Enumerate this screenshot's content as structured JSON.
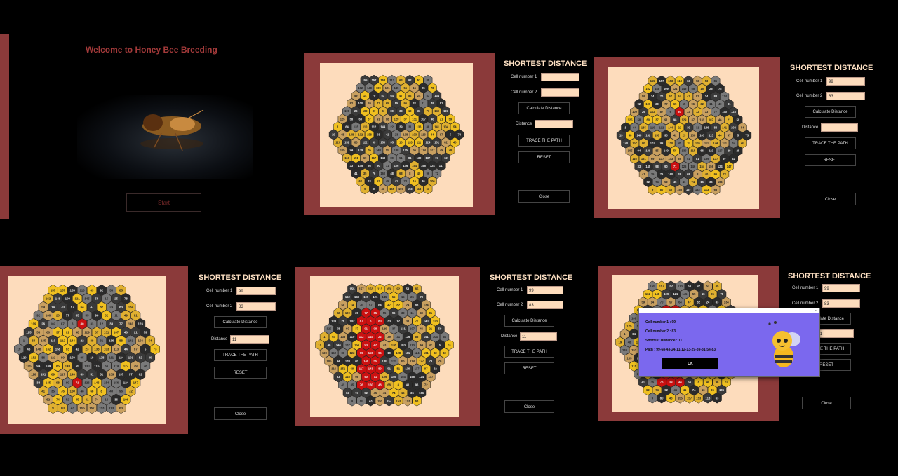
{
  "welcome": {
    "title": "Welcome to Honey Bee Breeding",
    "start_label": "Start"
  },
  "panels": [
    {
      "title": "SHORTEST DISTANCE",
      "cell1_label": "Cell number 1",
      "cell2_label": "Cell number 2",
      "cell1": "",
      "cell2": "",
      "calc_label": "Calculate Distance",
      "distance_label": "Distance",
      "distance": "",
      "trace_label": "TRACE THE PATH",
      "reset_label": "RESET",
      "close_label": "Close"
    },
    {
      "title": "SHORTEST DISTANCE",
      "cell1_label": "Cell number 1",
      "cell2_label": "Cell number 2",
      "cell1": "99",
      "cell2": "83",
      "calc_label": "Calculate Distance",
      "distance_label": "Distance",
      "distance": "",
      "trace_label": "TRACE THE PATH",
      "reset_label": "RESET",
      "close_label": "Close"
    },
    {
      "title": "SHORTEST DISTANCE",
      "cell1_label": "Cell number 1",
      "cell2_label": "Cell number 2",
      "cell1": "99",
      "cell2": "83",
      "calc_label": "Calculate Distance",
      "distance_label": "Distance",
      "distance": "11",
      "trace_label": "TRACE THE PATH",
      "reset_label": "RESET",
      "close_label": "Close"
    },
    {
      "title": "SHORTEST DISTANCE",
      "cell1_label": "Cell number 1",
      "cell2_label": "Cell number 2",
      "cell1": "99",
      "cell2": "83",
      "calc_label": "Calculate Distance",
      "distance_label": "Distance",
      "distance": "11",
      "trace_label": "TRACE THE PATH",
      "reset_label": "RESET",
      "close_label": "Close"
    },
    {
      "title": "SHORTEST DISTANCE",
      "cell1_label": "Cell number 1",
      "cell2_label": "Cell number 2",
      "cell1": "99",
      "cell2": "83",
      "calc_label": "Calculate Distance",
      "distance_label": "Distance",
      "distance": "11",
      "trace_label": "TRACE THE PATH",
      "reset_label": "RESET",
      "close_label": "Close"
    }
  ],
  "dialog": {
    "cell1_line": "Cell number 1 : 99",
    "cell2_line": "Cell number 2 : 83",
    "distance_line": "Shortest Distance : 11",
    "path_line": "Path : 99-68-43-24-11-12-13-29-39-31-54-83",
    "ok_label": "OK"
  },
  "board": {
    "visible_numbers": [
      155,
      157,
      153,
      113,
      63,
      92,
      53,
      85,
      162,
      148,
      109,
      121,
      145,
      55,
      15,
      25,
      78,
      59,
      14,
      70,
      57,
      64,
      47,
      82,
      24,
      83,
      134,
      92,
      100,
      20,
      77,
      65,
      55,
      96,
      32,
      11,
      49,
      81,
      109,
      26,
      102,
      87,
      6,
      80,
      33,
      12,
      33,
      77,
      140,
      123,
      125,
      58,
      60,
      37,
      91,
      98,
      129,
      37,
      131,
      107,
      46,
      21,
      59,
      1,
      64,
      135,
      110,
      112,
      144,
      22,
      39,
      31,
      136,
      88,
      141,
      104,
      54,
      19,
      48,
      148,
      132,
      158,
      93,
      42,
      23,
      138,
      103,
      113,
      44,
      97,
      5,
      73,
      120,
      152,
      86,
      122,
      99,
      150,
      95,
      10,
      128,
      111,
      124,
      101,
      82,
      40,
      105,
      94,
      139,
      85,
      149,
      55,
      130,
      115,
      66,
      119,
      127,
      29,
      28,
      116,
      151,
      69,
      117,
      143,
      89,
      51,
      81,
      139,
      137,
      97,
      62,
      33,
      145,
      98,
      90,
      71,
      126,
      146,
      154,
      156,
      124,
      147,
      41,
      35,
      76,
      160,
      48,
      68,
      8,
      40,
      96,
      72,
      62,
      74,
      52,
      45,
      41,
      74,
      16,
      36,
      106,
      9,
      80,
      43
    ],
    "path_colour": "#cc1111",
    "cell_colours": [
      "#2b2b2b",
      "#3a3a3a",
      "#7a7a7a",
      "#e0b030",
      "#c9a060",
      "#f0c020"
    ]
  }
}
